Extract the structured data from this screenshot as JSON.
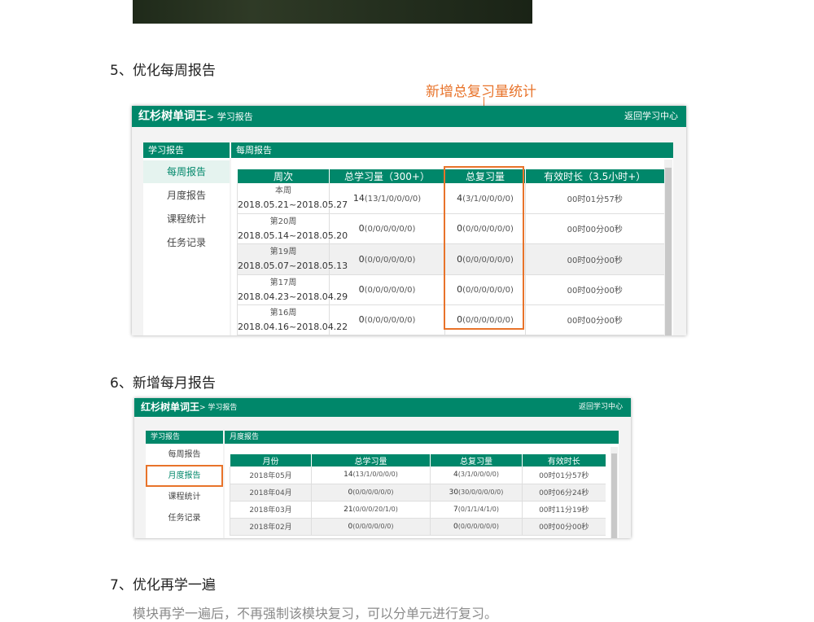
{
  "colors": {
    "brand_green": "#00876a",
    "highlight_orange": "#e8732a"
  },
  "sections": {
    "s5": "5、优化每周报告",
    "s6": "6、新增每月报告",
    "s7": "7、优化再学一遍",
    "s7_desc": "模块再学一遍后，不再强制该模块复习，可以分单元进行复习。"
  },
  "callout": "新增总复习量统计",
  "app": {
    "title": "红杉树单词王",
    "breadcrumb": "> 学习报告",
    "back_link": "返回学习中心",
    "sidebar_header": "学习报告",
    "sidebar_items": [
      "每周报告",
      "月度报告",
      "课程统计",
      "任务记录"
    ]
  },
  "weekly": {
    "panel_title": "每周报告",
    "columns": [
      "周次",
      "总学习量（300+）",
      "总复习量",
      "有效时长（3.5小时+）"
    ],
    "rows": [
      {
        "week": "本周",
        "range": "2018.05.21~2018.05.27",
        "learn": "14",
        "learn_detail": "(13/1/0/0/0/0)",
        "review": "4",
        "review_detail": "(3/1/0/0/0/0)",
        "time": "00时01分57秒"
      },
      {
        "week": "第20周",
        "range": "2018.05.14~2018.05.20",
        "learn": "0",
        "learn_detail": "(0/0/0/0/0/0)",
        "review": "0",
        "review_detail": "(0/0/0/0/0/0)",
        "time": "00时00分00秒"
      },
      {
        "week": "第19周",
        "range": "2018.05.07~2018.05.13",
        "learn": "0",
        "learn_detail": "(0/0/0/0/0/0)",
        "review": "0",
        "review_detail": "(0/0/0/0/0/0)",
        "time": "00时00分00秒"
      },
      {
        "week": "第17周",
        "range": "2018.04.23~2018.04.29",
        "learn": "0",
        "learn_detail": "(0/0/0/0/0/0)",
        "review": "0",
        "review_detail": "(0/0/0/0/0/0)",
        "time": "00时00分00秒"
      },
      {
        "week": "第16周",
        "range": "2018.04.16~2018.04.22",
        "learn": "0",
        "learn_detail": "(0/0/0/0/0/0)",
        "review": "0",
        "review_detail": "(0/0/0/0/0/0)",
        "time": "00时00分00秒"
      }
    ]
  },
  "monthly": {
    "panel_title": "月度报告",
    "columns": [
      "月份",
      "总学习量",
      "总复习量",
      "有效时长"
    ],
    "rows": [
      {
        "month": "2018年05月",
        "learn": "14",
        "learn_detail": "(13/1/0/0/0/0)",
        "review": "4",
        "review_detail": "(3/1/0/0/0/0)",
        "time": "00时01分57秒"
      },
      {
        "month": "2018年04月",
        "learn": "0",
        "learn_detail": "(0/0/0/0/0/0)",
        "review": "30",
        "review_detail": "(30/0/0/0/0/0)",
        "time": "00时06分24秒"
      },
      {
        "month": "2018年03月",
        "learn": "21",
        "learn_detail": "(0/0/0/20/1/0)",
        "review": "7",
        "review_detail": "(0/1/1/4/1/0)",
        "time": "00时11分19秒"
      },
      {
        "month": "2018年02月",
        "learn": "0",
        "learn_detail": "(0/0/0/0/0/0)",
        "review": "0",
        "review_detail": "(0/0/0/0/0/0)",
        "time": "00时00分00秒"
      }
    ]
  }
}
